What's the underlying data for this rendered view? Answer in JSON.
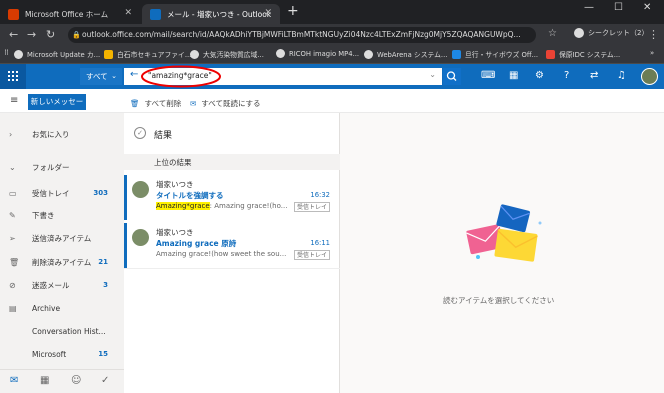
{
  "browser": {
    "tabs": [
      {
        "label": "Microsoft Office ホーム"
      },
      {
        "label": "メール - 増家いつき - Outlook"
      }
    ],
    "url": "outlook.office.com/mail/search/id/AAQkADhiYTBjMWFiLTBmMTktNGUyZi04Nzc4LTExZmFjNzg0MjY5ZQAQANGUWpQ...",
    "incognito_label": "シークレット（2）",
    "bookmarks": [
      {
        "label": "Microsoft Update カ...",
        "color": "#1e88e5"
      },
      {
        "label": "白石市セキュアファイ...",
        "color": "#f4b400"
      },
      {
        "label": "大気汚染物質広域...",
        "color": "#9e9e9e"
      },
      {
        "label": "RICOH imagio MP4...",
        "color": "#9e9e9e"
      },
      {
        "label": "WebArena システム...",
        "color": "#9e9e9e"
      },
      {
        "label": "旦行・サイボウズ Off...",
        "color": "#1e88e5"
      },
      {
        "label": "保原IDC システム...",
        "color": "#ea4335"
      }
    ]
  },
  "header": {
    "scope_label": "すべて",
    "search_value": "\"amazing*grace\"",
    "accent": "#0f6cbd"
  },
  "command_bar": {
    "new_message": "新しいメッセージ",
    "delete_all": "すべて削除",
    "mark_all_read": "すべて既読にする"
  },
  "sidebar": {
    "favorites": "お気に入り",
    "folders_label": "フォルダー",
    "items": [
      {
        "label": "受信トレイ",
        "count": "303",
        "icon": "inbox-icon"
      },
      {
        "label": "下書き",
        "count": "",
        "icon": "pencil-icon"
      },
      {
        "label": "送信済みアイテム",
        "count": "",
        "icon": "send-icon"
      },
      {
        "label": "削除済みアイテム",
        "count": "21",
        "icon": "trash-icon"
      },
      {
        "label": "迷惑メール",
        "count": "3",
        "icon": "blocked-icon"
      },
      {
        "label": "Archive",
        "count": "",
        "icon": "archive-icon"
      },
      {
        "label": "Conversation Hist...",
        "count": "",
        "icon": ""
      },
      {
        "label": "Microsoft",
        "count": "15",
        "icon": ""
      }
    ]
  },
  "results": {
    "title": "結果",
    "top_results": "上位の結果",
    "messages": [
      {
        "sender": "増家いつき",
        "subject": "タイトルを強調する",
        "time": "16:32",
        "preview_highlight": "Amazing*grace",
        "preview_rest": ": Amazing grace!(ho...",
        "badge": "受信トレイ"
      },
      {
        "sender": "増家いつき",
        "subject_highlight": "Amazing grace",
        "subject_rest": " 原詩",
        "time": "16:11",
        "preview": "Amazing grace!(how sweet the sou...",
        "badge": "受信トレイ"
      }
    ]
  },
  "reading_pane": {
    "empty_text": "読むアイテムを選択してください"
  }
}
